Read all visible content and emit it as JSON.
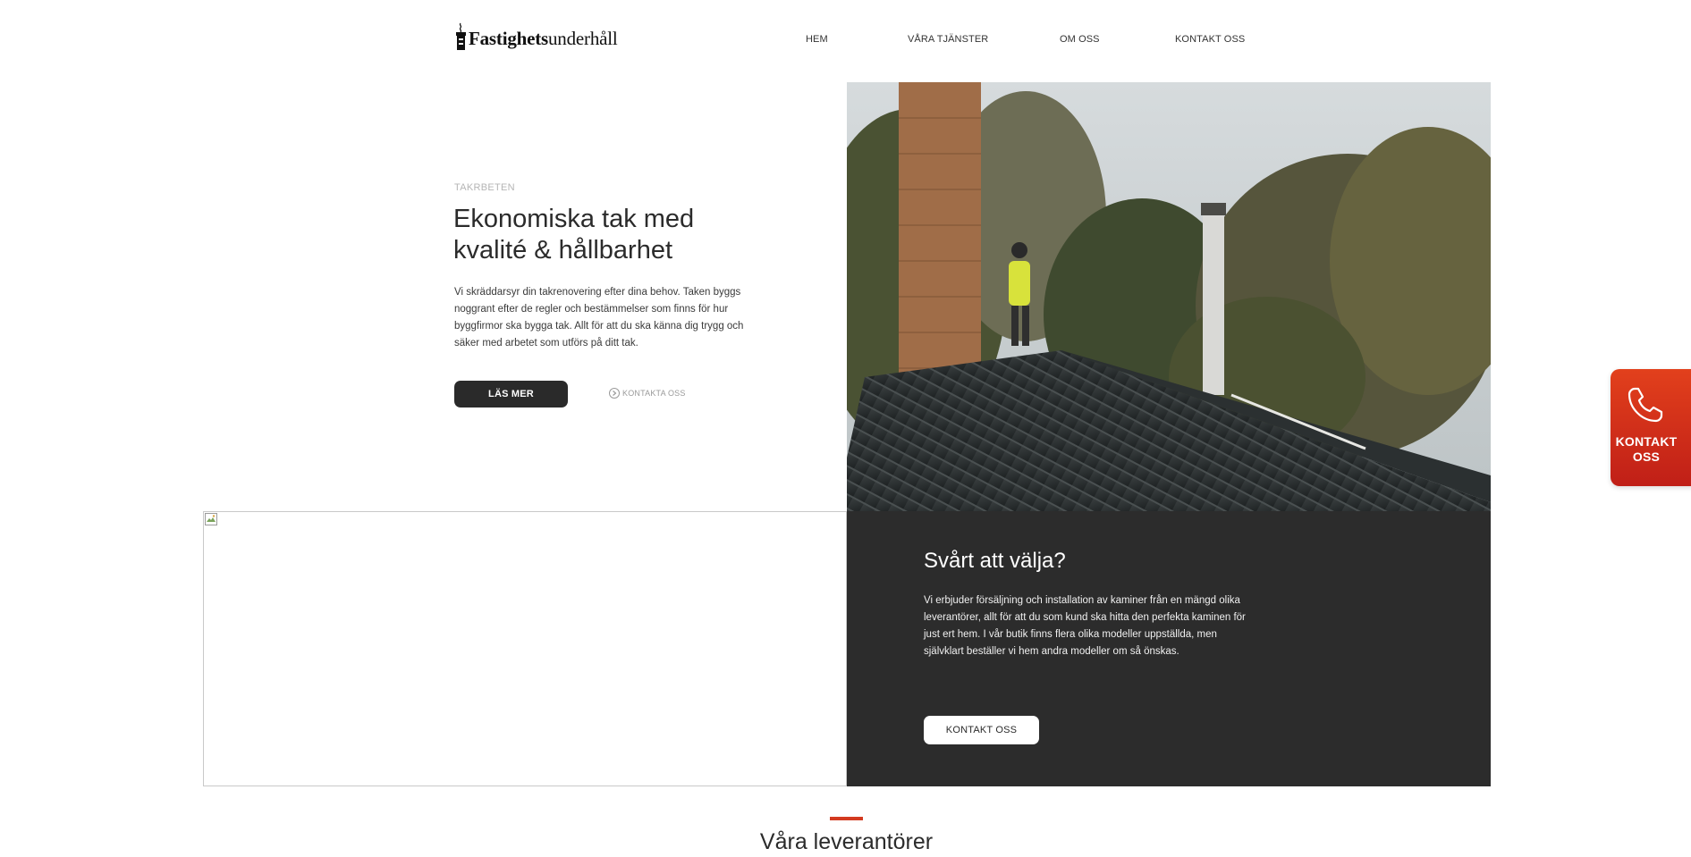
{
  "header": {
    "logo": {
      "bold_text": "Fastighets",
      "light_text": "underhåll"
    },
    "nav": [
      {
        "label": "HEM"
      },
      {
        "label": "VÅRA TJÄNSTER"
      },
      {
        "label": "OM OSS"
      },
      {
        "label": "KONTAKT OSS"
      }
    ]
  },
  "hero": {
    "eyebrow": "TAKRBETEN",
    "title": "Ekonomiska tak med kvalité & hållbarhet",
    "text": "Vi skräddarsyr din takrenovering efter dina behov. Taken byggs noggrant efter de regler och bestämmelser som finns för hur byggfirmor ska bygga tak. Allt för att du ska känna dig trygg och säker med arbetet som utförs på ditt tak.",
    "primary_button": "LÄS MER",
    "secondary_link": "KONTAKTA OSS",
    "secondary_link_icon": "arrow-circle-icon"
  },
  "info_panel": {
    "title": "Svårt att välja?",
    "text": "Vi erbjuder försäljning och installation av kaminer från en mängd olika leverantörer, allt för att du som kund ska hitta den perfekta kaminen för just ert hem. I vår butik finns flera olika modeller uppställda, men självklart beställer vi hem andra modeller om så önskas.",
    "button": "KONTAKT OSS"
  },
  "float_contact": {
    "label": "KONTAKT OSS",
    "icon": "phone-icon"
  },
  "suppliers": {
    "title": "Våra leverantörer"
  },
  "colors": {
    "dark": "#2c2c2c",
    "accent_red": "#d33a20",
    "float_gradient_top": "#e2401c",
    "float_gradient_bottom": "#c01f17"
  }
}
